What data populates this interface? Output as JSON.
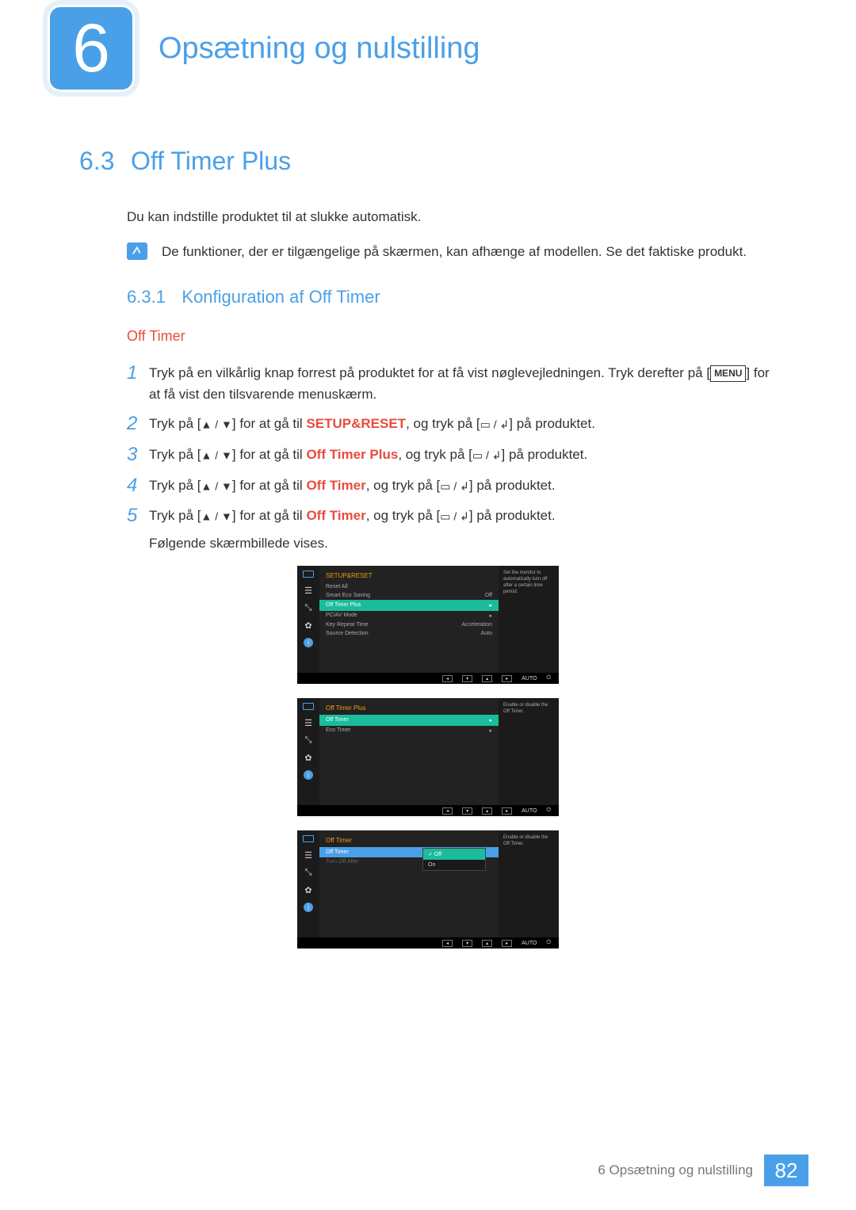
{
  "chapter": {
    "number": "6",
    "title": "Opsætning og nulstilling"
  },
  "section": {
    "number": "6.3",
    "title": "Off Timer Plus"
  },
  "intro": "Du kan indstille produktet til at slukke automatisk.",
  "note": "De funktioner, der er tilgængelige på skærmen, kan afhænge af modellen. Se det faktiske produkt.",
  "subsection": {
    "number": "6.3.1",
    "title": "Konfiguration af Off Timer"
  },
  "subhead": "Off Timer",
  "steps": {
    "s1a": "Tryk på en vilkårlig knap forrest på produktet for at få vist nøglevejledningen. Tryk derefter på [",
    "s1menu": "MENU",
    "s1b": "] for at få vist den tilsvarende menuskærm.",
    "s2a": "Tryk på [",
    "s2keys": "▲ / ▼",
    "s2b": "] for at gå til ",
    "s2target": "SETUP&RESET",
    "s2c": ", og tryk på [",
    "s2okicons": "▭ / ↲",
    "s2d": "] på produktet.",
    "s3a": "Tryk på [",
    "s3keys": "▲ / ▼",
    "s3b": "] for at gå til ",
    "s3target": "Off Timer Plus",
    "s3c": ", og tryk på [",
    "s3okicons": "▭ / ↲",
    "s3d": "] på produktet.",
    "s4a": "Tryk på [",
    "s4keys": "▲ / ▼",
    "s4b": "] for at gå til ",
    "s4target": "Off Timer",
    "s4c": ", og tryk på [",
    "s4okicons": "▭ / ↲",
    "s4d": "] på produktet.",
    "s5a": "Tryk på [",
    "s5keys": "▲ / ▼",
    "s5b": "] for at gå til ",
    "s5target": "Off Timer",
    "s5c": ", og tryk på [",
    "s5okicons": "▭ / ↲",
    "s5d": "] på produktet.",
    "s5follow": "Følgende skærmbillede vises."
  },
  "osd1": {
    "title": "SETUP&RESET",
    "rows": [
      {
        "l": "Reset All",
        "r": ""
      },
      {
        "l": "Smart Eco Saving",
        "r": "Off"
      }
    ],
    "hl": {
      "l": "Off Timer Plus",
      "r": "▸"
    },
    "rows2": [
      {
        "l": "PC/AV Mode",
        "r": "▸"
      },
      {
        "l": "Key Repeat Time",
        "r": "Acceleration"
      },
      {
        "l": "Source Detection",
        "r": "Auto"
      }
    ],
    "help": "Set the monitor to automatically turn off after a certain time period."
  },
  "osd2": {
    "title": "Off Timer Plus",
    "hl": {
      "l": "Off Timer",
      "r": "▸"
    },
    "rows2": [
      {
        "l": "Eco Timer",
        "r": "▸"
      }
    ],
    "help": "Enable or disable the Off Timer."
  },
  "osd3": {
    "title": "Off Timer",
    "hl": {
      "l": "Off Timer",
      "r": ""
    },
    "rows2": [
      {
        "l": "Turn Off After",
        "r": ""
      }
    ],
    "popup": {
      "sel": "Off",
      "other": "On",
      "check": "✓"
    },
    "help": "Enable or disable the Off Timer."
  },
  "navbar": {
    "left": "◂",
    "down": "▾",
    "up": "▴",
    "right": "▸",
    "auto": "AUTO",
    "power": "⏻"
  },
  "footer": {
    "text": "6 Opsætning og nulstilling",
    "page": "82"
  }
}
